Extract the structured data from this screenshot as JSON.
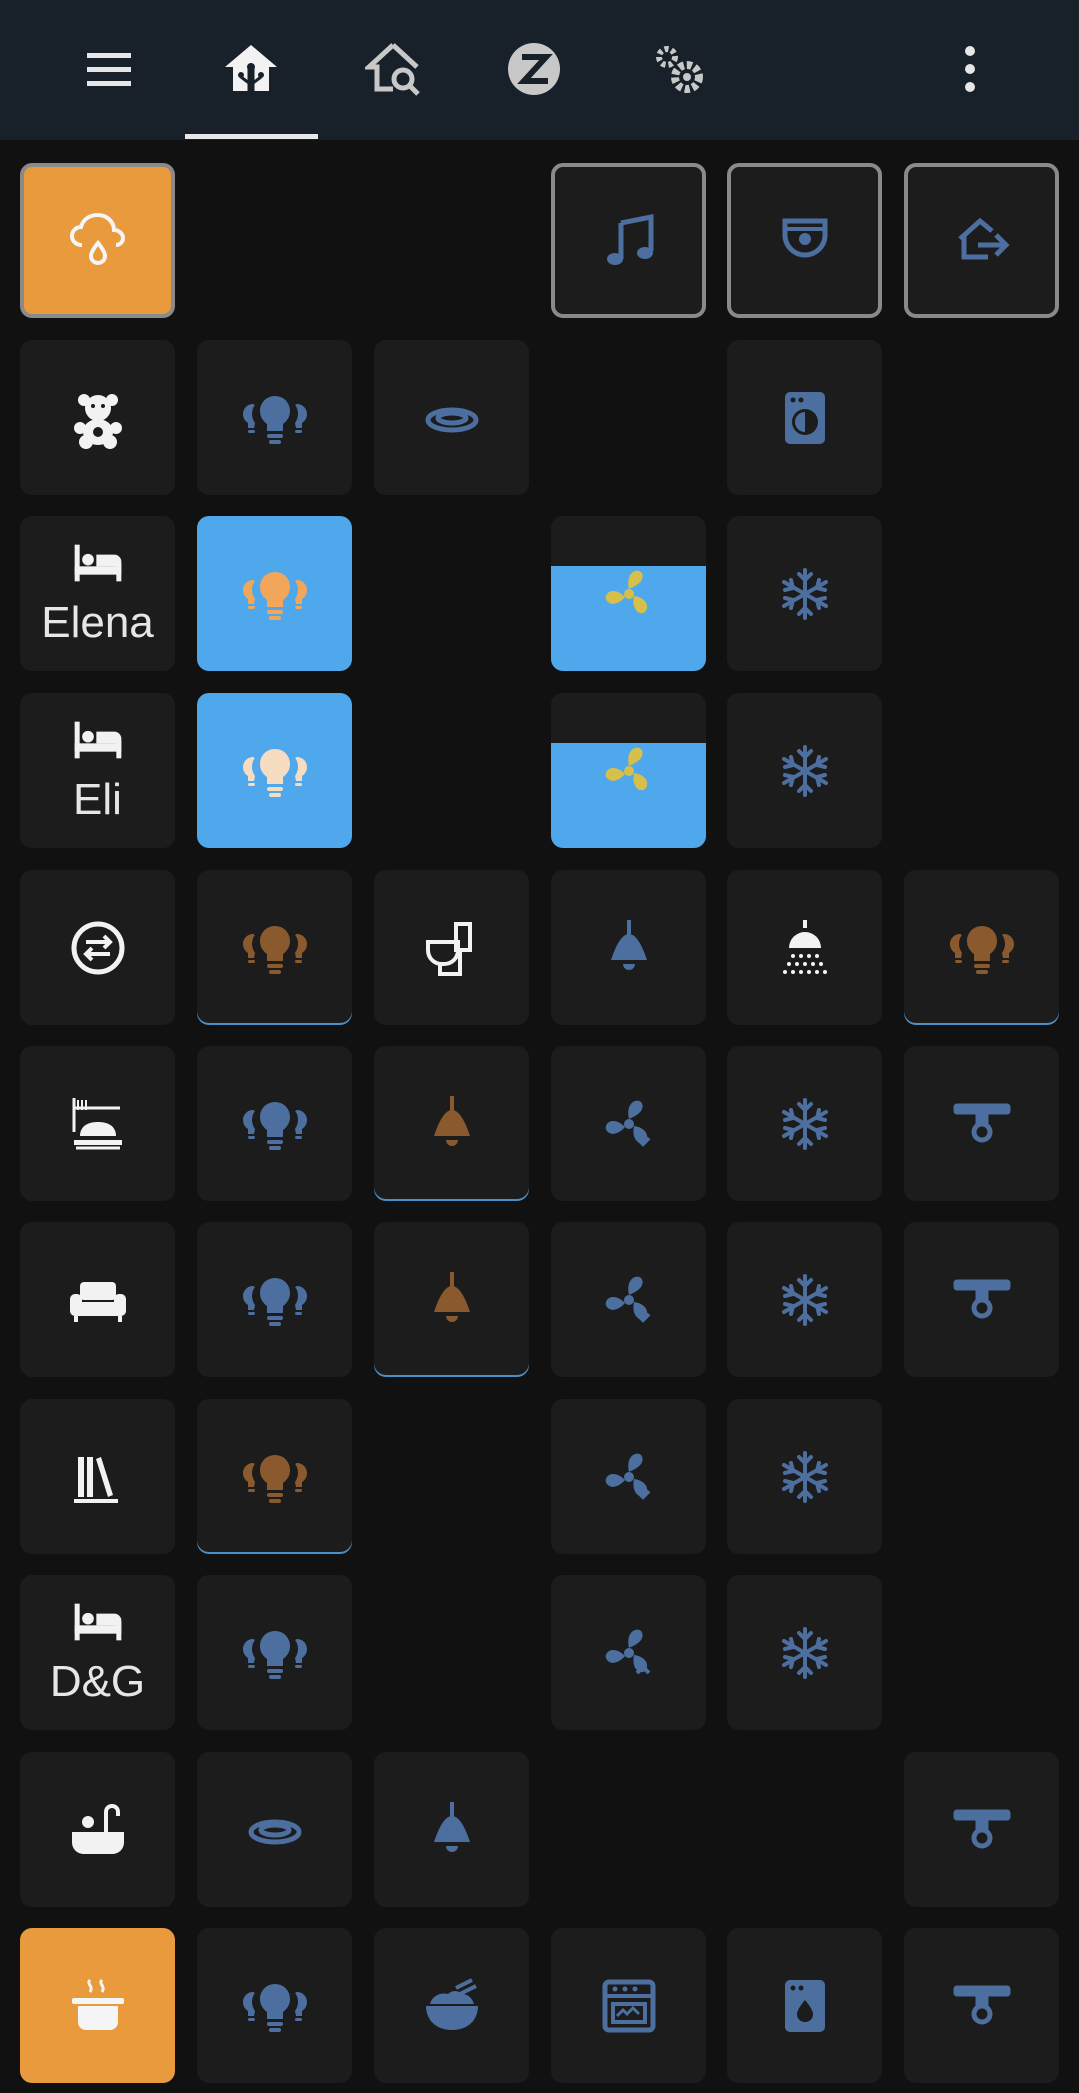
{
  "colors": {
    "topbar_bg": "#18202a",
    "page_bg": "#111111",
    "tile_bg": "#1c1c1c",
    "accent_orange": "#e89a3c",
    "accent_blue": "#4fa8ec",
    "icon_blue": "#4d6f9f",
    "icon_white": "#f2f2f2",
    "icon_brown": "#8a5a2e",
    "icon_yellow": "#d6c04a"
  },
  "toolbar": {
    "items": [
      {
        "name": "menu-icon"
      },
      {
        "name": "home-automation-icon",
        "selected": true
      },
      {
        "name": "home-search-icon"
      },
      {
        "name": "z-wave-icon"
      },
      {
        "name": "cogs-icon"
      },
      {
        "name": "more-vertical-icon"
      }
    ]
  },
  "tiles": {
    "labels": {
      "elena": "Elena",
      "eli": "Eli",
      "dg": "D&G"
    }
  }
}
